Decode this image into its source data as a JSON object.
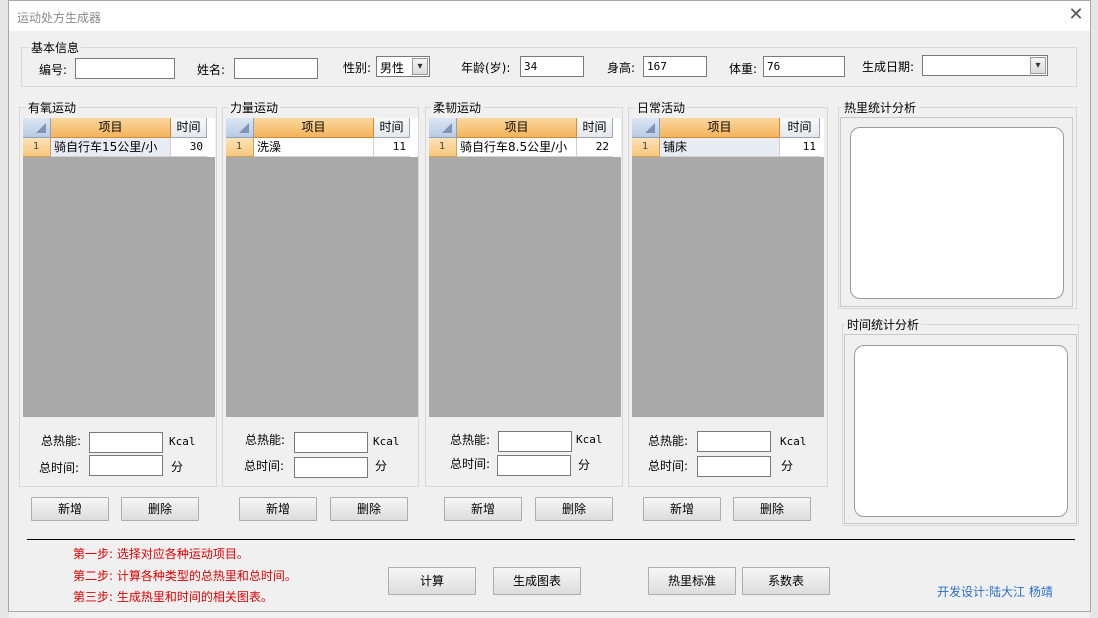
{
  "window": {
    "title": "运动处方生成器",
    "close_glyph": "✕"
  },
  "basic": {
    "legend": "基本信息",
    "id_label": "编号:",
    "id_value": "",
    "name_label": "姓名:",
    "name_value": "",
    "gender_label": "性别:",
    "gender_value": "男性",
    "age_label": "年龄(岁):",
    "age_value": "34",
    "height_label": "身高:",
    "height_value": "167",
    "weight_label": "体重:",
    "weight_value": "76",
    "date_label": "生成日期:",
    "date_value": ""
  },
  "grid_headers": {
    "item": "项目",
    "time": "时间"
  },
  "panels": [
    {
      "title": "有氧运动",
      "row_num": "1",
      "row_item": "骑自行车15公里/小",
      "row_time": "30",
      "energy_label": "总热能:",
      "energy_unit": "Kcal",
      "time_label": "总时间:",
      "time_unit": "分",
      "add_label": "新增",
      "delete_label": "删除"
    },
    {
      "title": "力量运动",
      "row_num": "1",
      "row_item": "洗澡",
      "row_time": "11",
      "energy_label": "总热能:",
      "energy_unit": "Kcal",
      "time_label": "总时间:",
      "time_unit": "分",
      "add_label": "新增",
      "delete_label": "删除"
    },
    {
      "title": "柔韧运动",
      "row_num": "1",
      "row_item": "骑自行车8.5公里/小",
      "row_time": "22",
      "energy_label": "总热能:",
      "energy_unit": "Kcal",
      "time_label": "总时间:",
      "time_unit": "分",
      "add_label": "新增",
      "delete_label": "删除"
    },
    {
      "title": "日常活动",
      "row_num": "1",
      "row_item": "铺床",
      "row_time": "11",
      "energy_label": "总热能:",
      "energy_unit": "Kcal",
      "time_label": "总时间:",
      "time_unit": "分",
      "add_label": "新增",
      "delete_label": "删除"
    }
  ],
  "analysis": {
    "energy_title": "热里统计分析",
    "time_title": "时间统计分析"
  },
  "steps": [
    "第一步: 选择对应各种运动项目。",
    "第二步: 计算各种类型的总热里和总时间。",
    "第三步: 生成热里和时间的相关图表。"
  ],
  "actions": {
    "calc": "计算",
    "chart": "生成图表",
    "energy_std": "热里标准",
    "coef": "系数表"
  },
  "credit": "开发设计:陆大江  杨靖",
  "colors": {
    "step_text": "#e00000",
    "credit_text": "#2a6fc9",
    "grid_bg": "#a9a9a9",
    "header_accent": "#f4b45c"
  }
}
